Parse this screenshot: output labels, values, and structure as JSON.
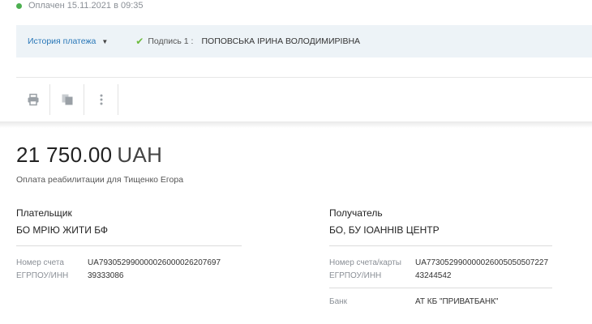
{
  "status": {
    "text": "Оплачен 15.11.2021 в 09:35",
    "color": "#4caf50"
  },
  "history": {
    "link_label": "История платежа",
    "signature_label": "Подпись 1 :",
    "signature_name": "ПОПОВСЬКА ІРИНА ВОЛОДИМИРІВНА"
  },
  "toolbar": {
    "icons": [
      "print-icon",
      "copy-icon",
      "more-vertical-icon"
    ]
  },
  "payment": {
    "amount": "21 750.00",
    "currency": "UAH",
    "purpose": "Оплата реабилитации для Тищенко Егора"
  },
  "payer": {
    "title": "Плательщик",
    "name": "БО МРІЮ ЖИТИ БФ",
    "account_label": "Номер счета",
    "account_value": "UA793052990000026000026207697",
    "tax_label": "ЕГРПОУ/ИНН",
    "tax_value": "39333086"
  },
  "recipient": {
    "title": "Получатель",
    "name": "БО, БУ ІОАННІВ ЦЕНТР",
    "account_label": "Номер счета/карты",
    "account_value": "UA773052990000026005050507227",
    "tax_label": "ЕГРПОУ/ИНН",
    "tax_value": "43244542",
    "bank_label": "Банк",
    "bank_value": "АТ КБ \"ПРИВАТБАНК\""
  },
  "colors": {
    "accent_link": "#2a78b8",
    "history_bg": "#edf3f7",
    "check_green": "#6cbb3c"
  }
}
